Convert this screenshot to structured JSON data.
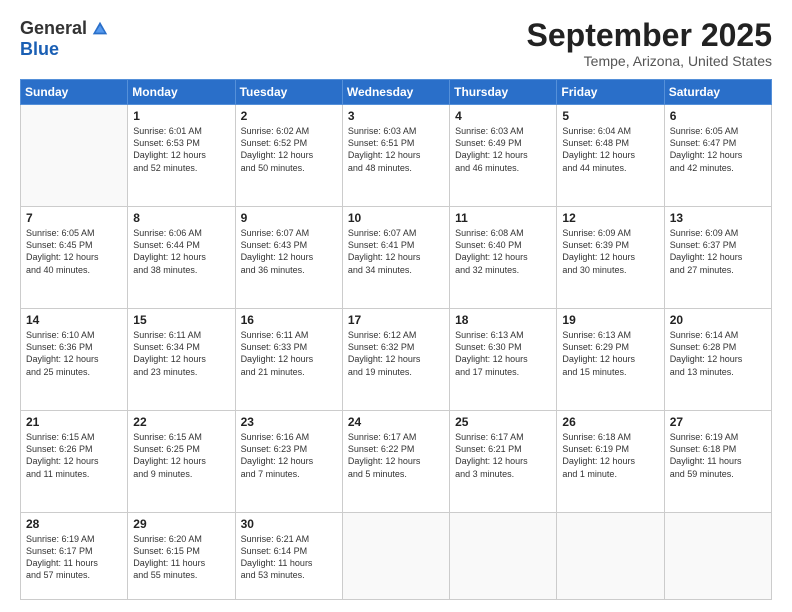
{
  "header": {
    "logo_general": "General",
    "logo_blue": "Blue",
    "title": "September 2025",
    "location": "Tempe, Arizona, United States"
  },
  "weekdays": [
    "Sunday",
    "Monday",
    "Tuesday",
    "Wednesday",
    "Thursday",
    "Friday",
    "Saturday"
  ],
  "weeks": [
    [
      {
        "day": "",
        "info": ""
      },
      {
        "day": "1",
        "info": "Sunrise: 6:01 AM\nSunset: 6:53 PM\nDaylight: 12 hours\nand 52 minutes."
      },
      {
        "day": "2",
        "info": "Sunrise: 6:02 AM\nSunset: 6:52 PM\nDaylight: 12 hours\nand 50 minutes."
      },
      {
        "day": "3",
        "info": "Sunrise: 6:03 AM\nSunset: 6:51 PM\nDaylight: 12 hours\nand 48 minutes."
      },
      {
        "day": "4",
        "info": "Sunrise: 6:03 AM\nSunset: 6:49 PM\nDaylight: 12 hours\nand 46 minutes."
      },
      {
        "day": "5",
        "info": "Sunrise: 6:04 AM\nSunset: 6:48 PM\nDaylight: 12 hours\nand 44 minutes."
      },
      {
        "day": "6",
        "info": "Sunrise: 6:05 AM\nSunset: 6:47 PM\nDaylight: 12 hours\nand 42 minutes."
      }
    ],
    [
      {
        "day": "7",
        "info": "Sunrise: 6:05 AM\nSunset: 6:45 PM\nDaylight: 12 hours\nand 40 minutes."
      },
      {
        "day": "8",
        "info": "Sunrise: 6:06 AM\nSunset: 6:44 PM\nDaylight: 12 hours\nand 38 minutes."
      },
      {
        "day": "9",
        "info": "Sunrise: 6:07 AM\nSunset: 6:43 PM\nDaylight: 12 hours\nand 36 minutes."
      },
      {
        "day": "10",
        "info": "Sunrise: 6:07 AM\nSunset: 6:41 PM\nDaylight: 12 hours\nand 34 minutes."
      },
      {
        "day": "11",
        "info": "Sunrise: 6:08 AM\nSunset: 6:40 PM\nDaylight: 12 hours\nand 32 minutes."
      },
      {
        "day": "12",
        "info": "Sunrise: 6:09 AM\nSunset: 6:39 PM\nDaylight: 12 hours\nand 30 minutes."
      },
      {
        "day": "13",
        "info": "Sunrise: 6:09 AM\nSunset: 6:37 PM\nDaylight: 12 hours\nand 27 minutes."
      }
    ],
    [
      {
        "day": "14",
        "info": "Sunrise: 6:10 AM\nSunset: 6:36 PM\nDaylight: 12 hours\nand 25 minutes."
      },
      {
        "day": "15",
        "info": "Sunrise: 6:11 AM\nSunset: 6:34 PM\nDaylight: 12 hours\nand 23 minutes."
      },
      {
        "day": "16",
        "info": "Sunrise: 6:11 AM\nSunset: 6:33 PM\nDaylight: 12 hours\nand 21 minutes."
      },
      {
        "day": "17",
        "info": "Sunrise: 6:12 AM\nSunset: 6:32 PM\nDaylight: 12 hours\nand 19 minutes."
      },
      {
        "day": "18",
        "info": "Sunrise: 6:13 AM\nSunset: 6:30 PM\nDaylight: 12 hours\nand 17 minutes."
      },
      {
        "day": "19",
        "info": "Sunrise: 6:13 AM\nSunset: 6:29 PM\nDaylight: 12 hours\nand 15 minutes."
      },
      {
        "day": "20",
        "info": "Sunrise: 6:14 AM\nSunset: 6:28 PM\nDaylight: 12 hours\nand 13 minutes."
      }
    ],
    [
      {
        "day": "21",
        "info": "Sunrise: 6:15 AM\nSunset: 6:26 PM\nDaylight: 12 hours\nand 11 minutes."
      },
      {
        "day": "22",
        "info": "Sunrise: 6:15 AM\nSunset: 6:25 PM\nDaylight: 12 hours\nand 9 minutes."
      },
      {
        "day": "23",
        "info": "Sunrise: 6:16 AM\nSunset: 6:23 PM\nDaylight: 12 hours\nand 7 minutes."
      },
      {
        "day": "24",
        "info": "Sunrise: 6:17 AM\nSunset: 6:22 PM\nDaylight: 12 hours\nand 5 minutes."
      },
      {
        "day": "25",
        "info": "Sunrise: 6:17 AM\nSunset: 6:21 PM\nDaylight: 12 hours\nand 3 minutes."
      },
      {
        "day": "26",
        "info": "Sunrise: 6:18 AM\nSunset: 6:19 PM\nDaylight: 12 hours\nand 1 minute."
      },
      {
        "day": "27",
        "info": "Sunrise: 6:19 AM\nSunset: 6:18 PM\nDaylight: 11 hours\nand 59 minutes."
      }
    ],
    [
      {
        "day": "28",
        "info": "Sunrise: 6:19 AM\nSunset: 6:17 PM\nDaylight: 11 hours\nand 57 minutes."
      },
      {
        "day": "29",
        "info": "Sunrise: 6:20 AM\nSunset: 6:15 PM\nDaylight: 11 hours\nand 55 minutes."
      },
      {
        "day": "30",
        "info": "Sunrise: 6:21 AM\nSunset: 6:14 PM\nDaylight: 11 hours\nand 53 minutes."
      },
      {
        "day": "",
        "info": ""
      },
      {
        "day": "",
        "info": ""
      },
      {
        "day": "",
        "info": ""
      },
      {
        "day": "",
        "info": ""
      }
    ]
  ]
}
